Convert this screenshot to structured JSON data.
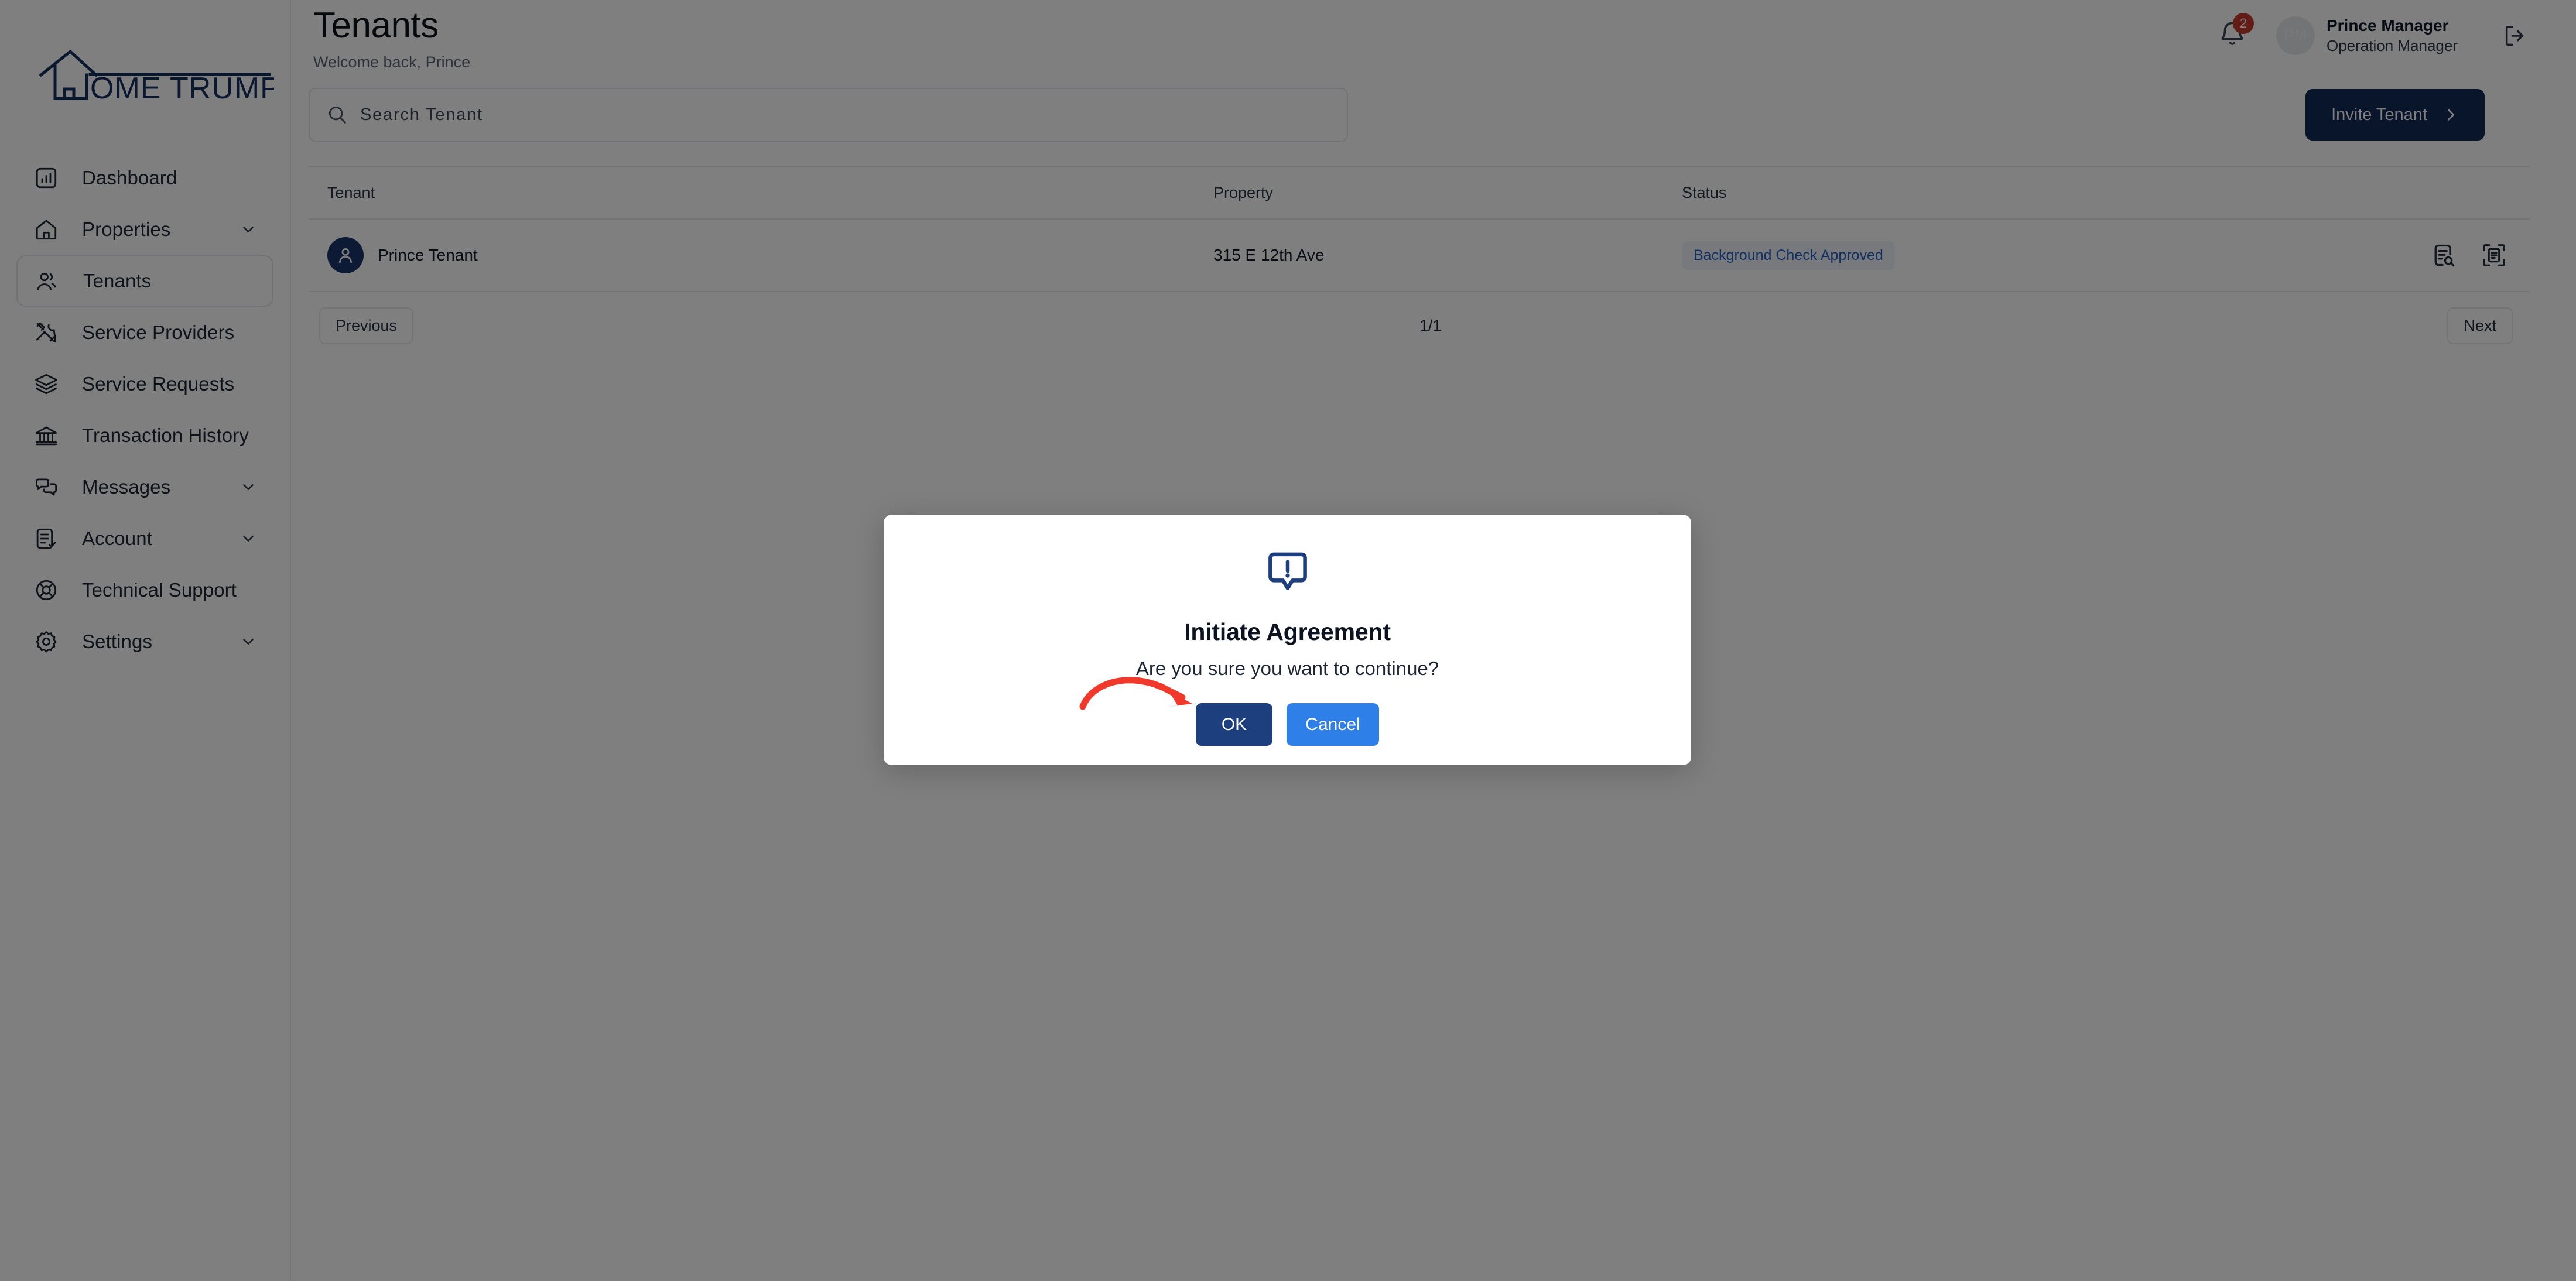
{
  "brand": {
    "logo_text": "OME TRUMPETER",
    "logo_full_name": "HOME TRUMPETER",
    "logo_color": "#15305e"
  },
  "sidebar": {
    "items": [
      {
        "label": "Dashboard",
        "icon": "chart-bar-icon",
        "active": false,
        "expandable": false
      },
      {
        "label": "Properties",
        "icon": "home-icon",
        "active": false,
        "expandable": true
      },
      {
        "label": "Tenants",
        "icon": "users-icon",
        "active": true,
        "expandable": false
      },
      {
        "label": "Service Providers",
        "icon": "tools-icon",
        "active": false,
        "expandable": false
      },
      {
        "label": "Service Requests",
        "icon": "layers-icon",
        "active": false,
        "expandable": false
      },
      {
        "label": "Transaction History",
        "icon": "bank-icon",
        "active": false,
        "expandable": false
      },
      {
        "label": "Messages",
        "icon": "chat-bubbles-icon",
        "active": false,
        "expandable": true
      },
      {
        "label": "Account",
        "icon": "document-check-icon",
        "active": false,
        "expandable": true
      },
      {
        "label": "Technical Support",
        "icon": "lifebuoy-icon",
        "active": false,
        "expandable": false
      },
      {
        "label": "Settings",
        "icon": "gear-icon",
        "active": false,
        "expandable": true
      }
    ]
  },
  "header": {
    "title": "Tenants",
    "subtitle": "Welcome back, Prince",
    "notifications": {
      "icon": "bell-icon",
      "count": "2",
      "badge_color": "#c0392b"
    },
    "user": {
      "initials": "PM",
      "name": "Prince Manager",
      "role": "Operation Manager"
    },
    "logout_icon": "logout-icon"
  },
  "toolbar": {
    "search": {
      "icon": "search-icon",
      "placeholder": "Search Tenant",
      "value": ""
    },
    "invite_button": {
      "label": "Invite Tenant",
      "icon": "chevron-right-icon",
      "color": "#102a54"
    }
  },
  "table": {
    "columns": [
      "Tenant",
      "Property",
      "Status",
      ""
    ],
    "rows": [
      {
        "tenant": "Prince Tenant",
        "property": "315 E 12th Ave",
        "status": "Background Check Approved",
        "status_color": "#2563c4",
        "actions": [
          "document-search-icon",
          "document-scan-icon"
        ]
      }
    ]
  },
  "pagination": {
    "previous_label": "Previous",
    "page_indicator": "1/1",
    "next_label": "Next"
  },
  "modal": {
    "icon": "alert-speech-bubble-icon",
    "icon_color": "#1e3f7e",
    "title": "Initiate Agreement",
    "message": "Are you sure you want to continue?",
    "ok_label": "OK",
    "cancel_label": "Cancel",
    "ok_color": "#1e3f7e",
    "cancel_color": "#2f7fe8"
  },
  "annotation": {
    "type": "curved-arrow",
    "color": "#f0382b",
    "points_to": "OK"
  }
}
